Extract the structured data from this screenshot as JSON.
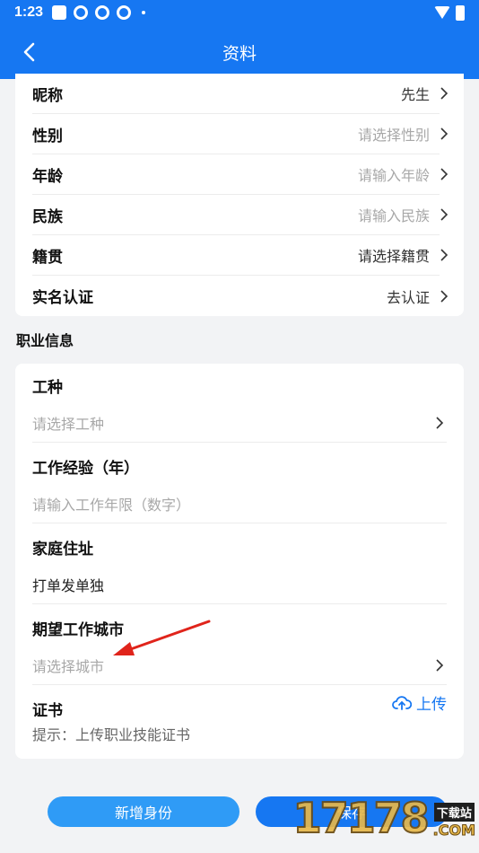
{
  "status_bar": {
    "time": "1:23"
  },
  "header": {
    "title": "资料"
  },
  "profile": {
    "rows": [
      {
        "label": "昵称",
        "value": "先生"
      },
      {
        "label": "性别",
        "value": "请选择性别"
      },
      {
        "label": "年龄",
        "value": "请输入年龄"
      },
      {
        "label": "民族",
        "value": "请输入民族"
      },
      {
        "label": "籍贯",
        "value": "请选择籍贯"
      },
      {
        "label": "实名认证",
        "value": "去认证"
      }
    ]
  },
  "job": {
    "section_title": "职业信息",
    "work_type": {
      "label": "工种",
      "placeholder": "请选择工种"
    },
    "experience": {
      "label": "工作经验（年）",
      "placeholder": "请输入工作年限（数字）"
    },
    "address": {
      "label": "家庭住址",
      "value": "打单发单独"
    },
    "city": {
      "label": "期望工作城市",
      "placeholder": "请选择城市"
    },
    "certificate": {
      "label": "证书",
      "upload_label": "上传",
      "hint": "提示：上传职业技能证书"
    }
  },
  "buttons": {
    "add_identity": "新增身份",
    "save": "保存"
  },
  "watermark": {
    "number": "17178",
    "badge": "下载站",
    "domain": ".COM"
  },
  "colors": {
    "primary": "#1677f2",
    "secondary_button": "#2f9bf6",
    "arrow": "#e0241b"
  }
}
